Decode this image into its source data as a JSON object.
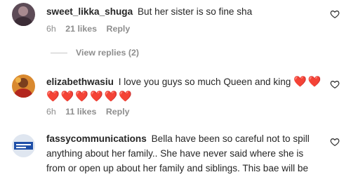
{
  "comments": [
    {
      "username": "sweet_likka_shuga",
      "text": "But her sister is so fine sha",
      "time": "6h",
      "likes": "21 likes",
      "reply": "Reply",
      "view_replies": "View replies (2)"
    },
    {
      "username": "elizabethwasiu",
      "text": "I love you guys so much Queen and king",
      "hearts_inline": "❤️❤️",
      "hearts_line2": "❤️❤️❤️❤️❤️❤️",
      "time": "6h",
      "likes": "11 likes",
      "reply": "Reply"
    },
    {
      "username": "fassycommunications",
      "text": "Bella have been so careful not to spill anything about her family.. She have never said where she is from or open up about her family and siblings. This bae will be"
    }
  ],
  "icons": {
    "like": "heart-outline-icon"
  },
  "colors": {
    "text": "#262626",
    "muted": "#8e8e8e",
    "heart": "#ed1c24"
  }
}
